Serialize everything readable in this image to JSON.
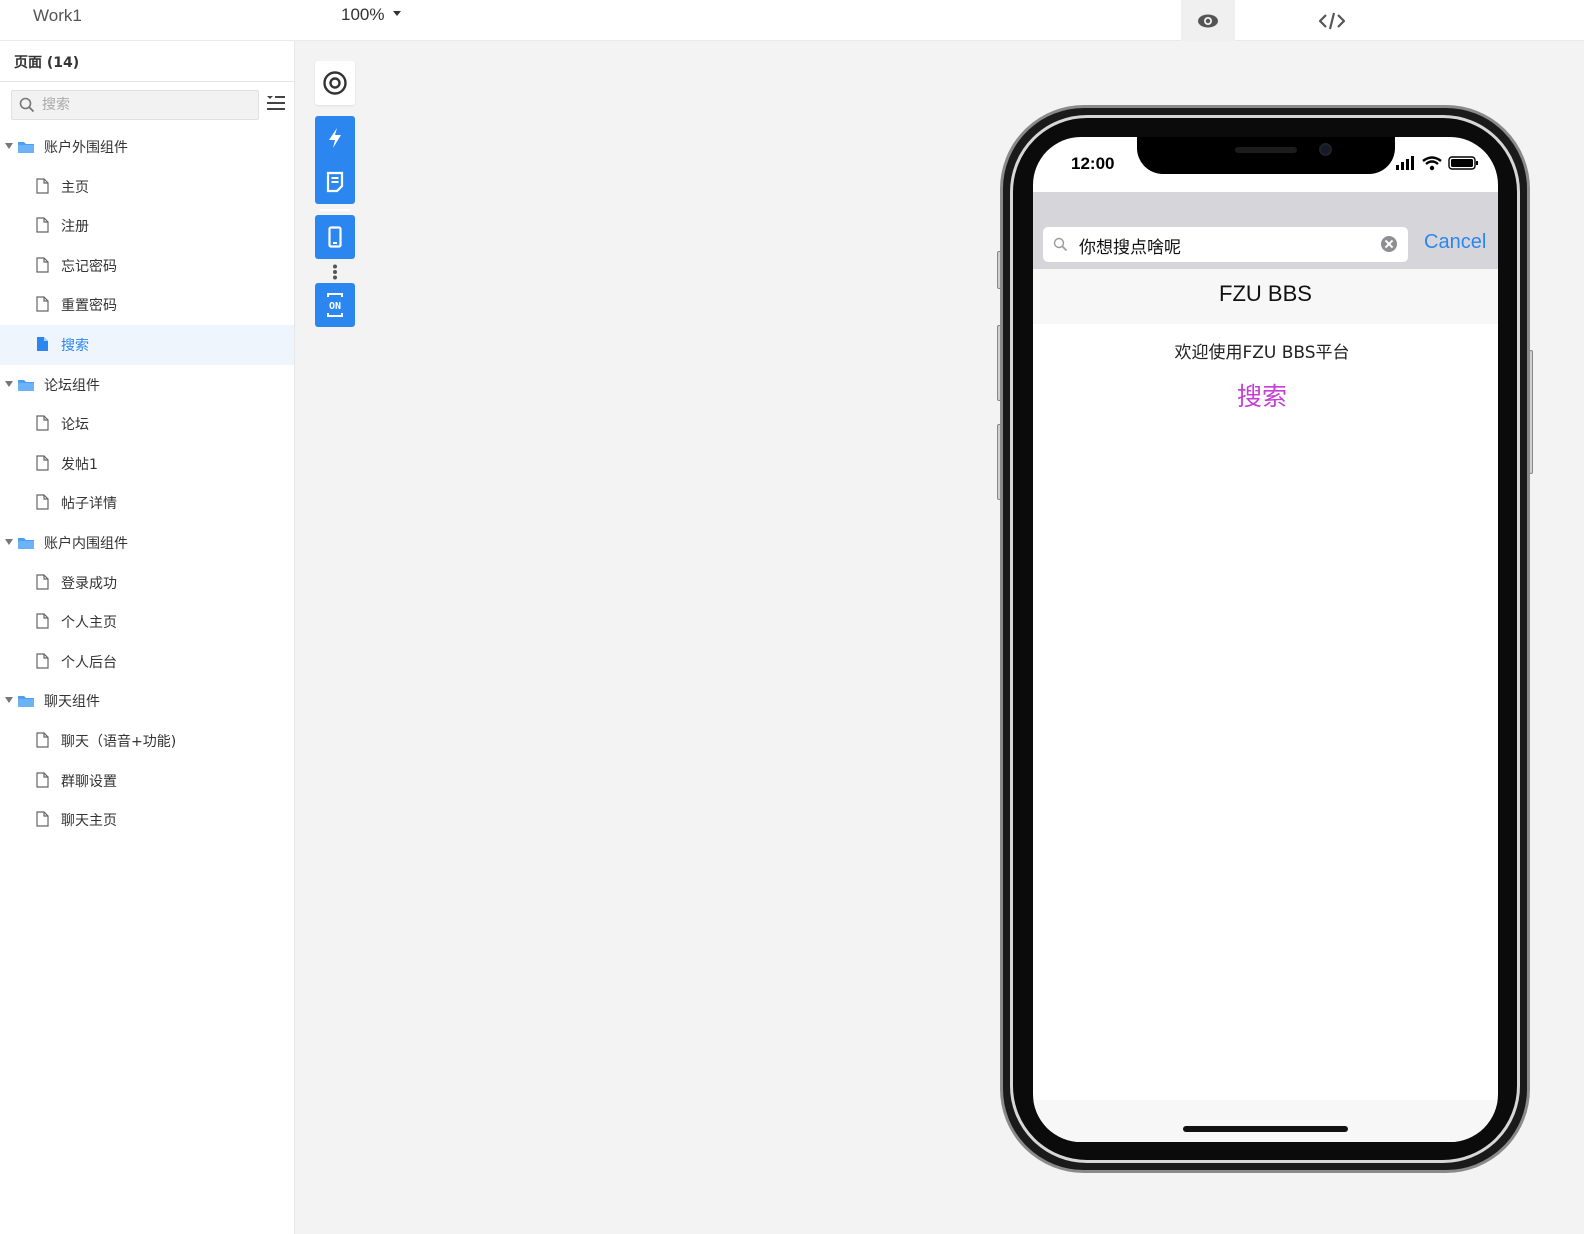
{
  "topbar": {
    "app_title": "Work1",
    "zoom": "100%"
  },
  "sidebar": {
    "pages_title": "页面 (14)",
    "search_placeholder": "搜索",
    "tree": [
      {
        "type": "folder",
        "label": "账户外围组件"
      },
      {
        "type": "page",
        "label": "主页"
      },
      {
        "type": "page",
        "label": "注册"
      },
      {
        "type": "page",
        "label": "忘记密码"
      },
      {
        "type": "page",
        "label": "重置密码"
      },
      {
        "type": "page",
        "label": "搜索",
        "selected": true
      },
      {
        "type": "folder",
        "label": "论坛组件"
      },
      {
        "type": "page",
        "label": "论坛"
      },
      {
        "type": "page",
        "label": "发帖1"
      },
      {
        "type": "page",
        "label": "帖子详情"
      },
      {
        "type": "folder",
        "label": "账户内围组件"
      },
      {
        "type": "page",
        "label": "登录成功"
      },
      {
        "type": "page",
        "label": "个人主页"
      },
      {
        "type": "page",
        "label": "个人后台"
      },
      {
        "type": "folder",
        "label": "聊天组件"
      },
      {
        "type": "page",
        "label": "聊天（语音+功能)"
      },
      {
        "type": "page",
        "label": "群聊设置"
      },
      {
        "type": "page",
        "label": "聊天主页"
      }
    ]
  },
  "toolbar": {
    "icons": [
      "target-icon",
      "lightning-icon",
      "note-icon",
      "phone-icon",
      "more-dots-icon",
      "on-toggle-icon"
    ],
    "on_label": "ON"
  },
  "phone": {
    "time": "12:00",
    "search_query": "你想搜点啥呢",
    "cancel": "Cancel",
    "nav_title": "FZU BBS",
    "welcome": "欢迎使用FZU BBS平台",
    "search_link": "搜索"
  },
  "colors": {
    "accent": "#2b86f0",
    "link_purple": "#c53ed6",
    "search_bar_bg": "#d6d6da",
    "canvas_bg": "#f3f3f3"
  }
}
